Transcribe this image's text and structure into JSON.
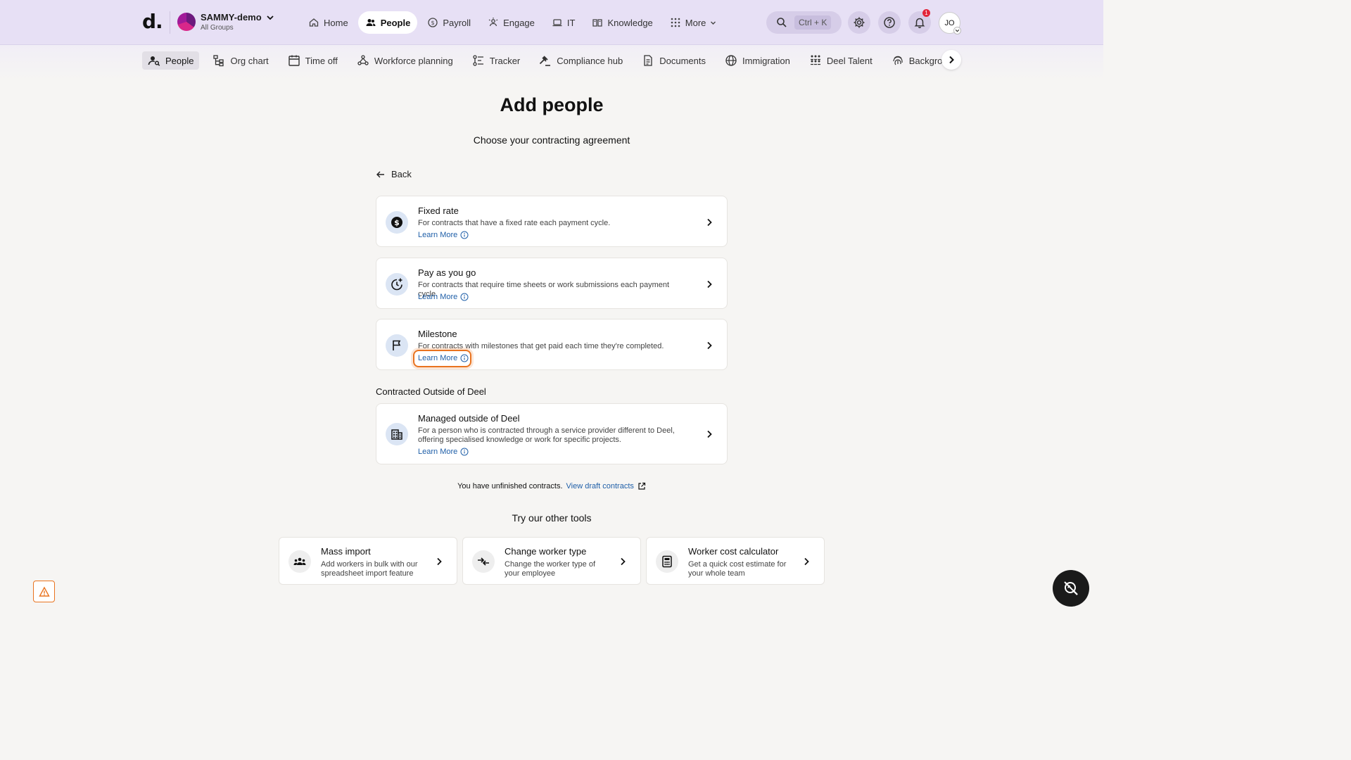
{
  "header": {
    "logo": "d.",
    "org_name": "SAMMY-demo",
    "org_sub": "All Groups",
    "nav": [
      {
        "label": "Home",
        "icon": "home-icon"
      },
      {
        "label": "People",
        "icon": "people-icon",
        "active": true
      },
      {
        "label": "Payroll",
        "icon": "dollar-icon"
      },
      {
        "label": "Engage",
        "icon": "engage-icon"
      },
      {
        "label": "IT",
        "icon": "laptop-icon"
      },
      {
        "label": "Knowledge",
        "icon": "book-icon"
      },
      {
        "label": "More",
        "icon": "grid-icon"
      }
    ],
    "search_shortcut": "Ctrl + K",
    "notification_count": "1",
    "user_initials": "JO"
  },
  "subnav": {
    "items": [
      {
        "label": "People",
        "active": true
      },
      {
        "label": "Org chart"
      },
      {
        "label": "Time off"
      },
      {
        "label": "Workforce planning"
      },
      {
        "label": "Tracker"
      },
      {
        "label": "Compliance hub"
      },
      {
        "label": "Documents"
      },
      {
        "label": "Immigration"
      },
      {
        "label": "Deel Talent"
      },
      {
        "label": "Background checks"
      }
    ]
  },
  "main": {
    "title": "Add people",
    "subtitle": "Choose your contracting agreement",
    "back_label": "Back",
    "cards": [
      {
        "title": "Fixed rate",
        "description": "For contracts that have a fixed rate each payment cycle.",
        "learn_more": "Learn More",
        "icon": "dollar-circle-icon"
      },
      {
        "title": "Pay as you go",
        "description": "For contracts that require time sheets or work submissions each payment cycle.",
        "learn_more": "Learn More",
        "icon": "clock-plus-icon"
      },
      {
        "title": "Milestone",
        "description": "For contracts with milestones that get paid each time they're completed.",
        "learn_more": "Learn More",
        "icon": "flag-icon"
      }
    ],
    "section_outside": "Contracted Outside of Deel",
    "outside_card": {
      "title": "Managed outside of Deel",
      "description": "For a person who is contracted through a service provider different to Deel, offering specialised knowledge or work for specific projects.",
      "learn_more": "Learn More",
      "icon": "building-icon"
    },
    "unfinished_text": "You have unfinished contracts.",
    "draft_link": "View draft contracts",
    "tools_title": "Try our other tools",
    "tools": [
      {
        "title": "Mass import",
        "description": "Add workers in bulk with our spreadsheet import feature",
        "icon": "group-icon"
      },
      {
        "title": "Change worker type",
        "description": "Change the worker type of your employee",
        "icon": "swap-icon"
      },
      {
        "title": "Worker cost calculator",
        "description": "Get a quick cost estimate for your whole team",
        "icon": "calculator-icon"
      }
    ]
  },
  "colors": {
    "topbar": "#e7e0f5",
    "link": "#1f5fa8",
    "highlight": "#e9731f",
    "icon_bg": "#dbe5f4"
  }
}
